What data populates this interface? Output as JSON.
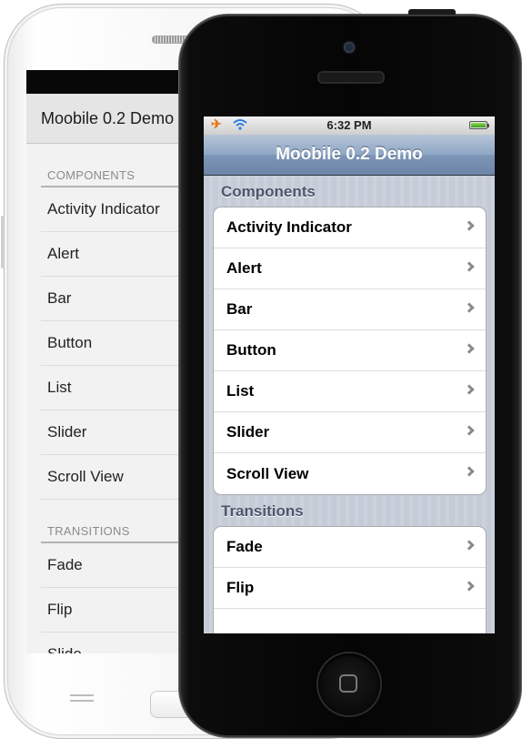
{
  "android": {
    "header_title": "Moobile 0.2 Demo",
    "sections": [
      {
        "title": "COMPONENTS",
        "items": [
          "Activity Indicator",
          "Alert",
          "Bar",
          "Button",
          "List",
          "Slider",
          "Scroll View"
        ]
      },
      {
        "title": "TRANSITIONS",
        "items": [
          "Fade",
          "Flip",
          "Slide"
        ]
      }
    ]
  },
  "iphone": {
    "status": {
      "time": "6:32 PM",
      "left_icons": [
        "airplane-icon",
        "wifi-icon"
      ],
      "right_icon": "battery-icon"
    },
    "nav_title": "Moobile 0.2 Demo",
    "sections": [
      {
        "title": "Components",
        "items": [
          "Activity Indicator",
          "Alert",
          "Bar",
          "Button",
          "List",
          "Slider",
          "Scroll View"
        ]
      },
      {
        "title": "Transitions",
        "items": [
          "Fade",
          "Flip"
        ]
      }
    ]
  },
  "colors": {
    "ios_nav": "#7d96b8",
    "ios_section_text": "#4c566c",
    "android_header": "#e5e5e5",
    "airplane": "#e8761a"
  }
}
